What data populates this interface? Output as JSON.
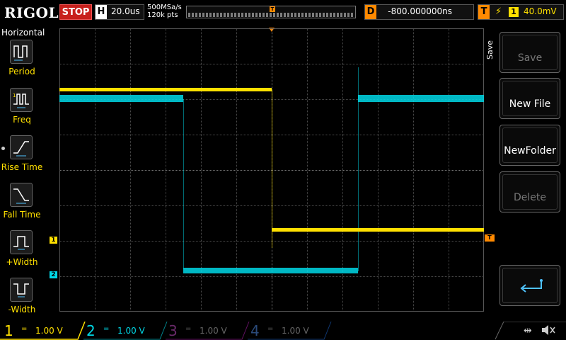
{
  "header": {
    "logo": "RIGOL",
    "run_state": "STOP",
    "timebase_key": "H",
    "timebase_value": "20.0us",
    "sample_rate": "500MSa/s",
    "mem_depth": "120k pts",
    "trigger_mark": "T",
    "delay_key": "D",
    "delay_value": "-800.000000ns",
    "trigger_key": "T",
    "trigger_edge": "⚡",
    "trigger_source": "1",
    "trigger_level": "40.0mV"
  },
  "left_menu": {
    "title": "Horizontal",
    "items": [
      {
        "label": "Period",
        "icon": "period-icon"
      },
      {
        "label": "Freq",
        "icon": "frequency-icon"
      },
      {
        "label": "Rise Time",
        "icon": "rise-time-icon"
      },
      {
        "label": "Fall Time",
        "icon": "fall-time-icon"
      },
      {
        "label": "+Width",
        "icon": "positive-width-icon"
      },
      {
        "label": "-Width",
        "icon": "negative-width-icon"
      }
    ]
  },
  "right_menu": {
    "title": "Save",
    "buttons": [
      {
        "label": "Save",
        "enabled": false
      },
      {
        "label": "New File",
        "enabled": true
      },
      {
        "label": "NewFolder",
        "enabled": true
      },
      {
        "label": "Delete",
        "enabled": false
      },
      {
        "label": "",
        "icon": "return-arrow-icon",
        "enabled": true
      }
    ]
  },
  "channels": [
    {
      "num": "1",
      "coupling": "=",
      "scale": "1.00 V",
      "color": "#ffe000",
      "active": true
    },
    {
      "num": "2",
      "coupling": "=",
      "scale": "1.00 V",
      "color": "#00d8e6",
      "active": true
    },
    {
      "num": "3",
      "coupling": "=",
      "scale": "1.00 V",
      "color": "#c020c0",
      "active": false
    },
    {
      "num": "4",
      "coupling": "=",
      "scale": "1.00 V",
      "color": "#1e6ee0",
      "active": false
    }
  ],
  "markers": {
    "ch1": "1",
    "ch2": "2",
    "trigger": "T"
  },
  "colors": {
    "ch1": "#ffe000",
    "ch2": "#00d8e6",
    "trigger": "#ff8a00",
    "stop": "#c8201c"
  }
}
